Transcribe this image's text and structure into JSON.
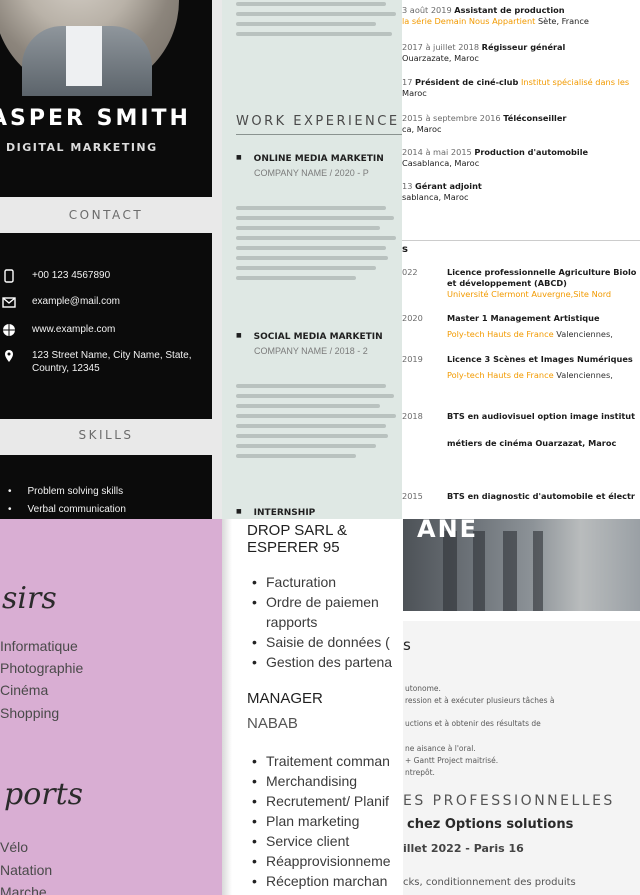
{
  "tile_a": {
    "name": "ASPER SMITH",
    "role": "DIGITAL MARKETING",
    "contact_title": "CONTACT",
    "contact": [
      {
        "icon": "phone-icon",
        "text": "+00 123 4567890"
      },
      {
        "icon": "email-icon",
        "text": "example@mail.com"
      },
      {
        "icon": "globe-icon",
        "text": "www.example.com"
      },
      {
        "icon": "location-pin-icon",
        "text": "123 Street Name, City Name, State, Country, 12345"
      }
    ],
    "skills_title": "SKILLS",
    "skills": [
      "Problem solving skills",
      "Verbal communication"
    ]
  },
  "tile_b": {
    "title": "WORK EXPERIENCE",
    "jobs": [
      {
        "title": "ONLINE MEDIA MARKETIN",
        "sub": "COMPANY NAME / 2020 - P"
      },
      {
        "title": "SOCIAL MEDIA MARKETIN",
        "sub": "COMPANY NAME / 2018 - 2"
      },
      {
        "title": "INTERNSHIP",
        "sub": ""
      }
    ]
  },
  "tile_c": {
    "experience": [
      {
        "date": "3 août 2019",
        "title": "Assistant de production",
        "org": "la série Demain Nous Appartient",
        "place": "Sète, France"
      },
      {
        "date": "2017 à juillet 2018",
        "title": "Régisseur général",
        "org": "",
        "place": "Ouarzazate, Maroc"
      },
      {
        "date": "17",
        "title": "Président de ciné-club",
        "org": "Institut spécialisé dans les",
        "place": "Maroc"
      },
      {
        "date": "2015 à septembre 2016",
        "title": "Téléconseiller",
        "org": "",
        "place": "ca, Maroc"
      },
      {
        "date": "2014 à mai 2015",
        "title": "Production d'automobile",
        "org": "",
        "place": "Casablanca, Maroc"
      },
      {
        "date": "13",
        "title": "Gérant adjoint",
        "org": "",
        "place": "sablanca, Maroc"
      }
    ],
    "section_mark": "s",
    "education": [
      {
        "year": "022",
        "title": "Licence professionnelle Agriculture Biolo",
        "title2": "et développement (ABCD)",
        "org": "Université Clermont Auvergne,Site Nord",
        "place": ""
      },
      {
        "year": "2020",
        "title": "Master 1 Management Artistique",
        "title2": "",
        "org": "Poly-tech Hauts de France",
        "place": "Valenciennes,"
      },
      {
        "year": "2019",
        "title": "Licence 3 Scènes et Images Numériques",
        "title2": "",
        "org": "Poly-tech Hauts de France",
        "place": "Valenciennes,"
      },
      {
        "year": "2018",
        "title": "BTS en audiovisuel option image institut",
        "title2": "",
        "org": "",
        "place": ""
      },
      {
        "year": "",
        "title": "métiers de cinéma Ouarzazat, Maroc",
        "title2": "",
        "org": "",
        "place": ""
      },
      {
        "year": "2015",
        "title": "BTS en diagnostic d'automobile et électr",
        "title2": "",
        "org": "",
        "place": ""
      }
    ]
  },
  "tile_d": {
    "heading1": "sirs",
    "hobbies": [
      "Informatique",
      "Photographie",
      "Cinéma",
      "Shopping"
    ],
    "heading2": "ports",
    "sports": [
      "Vélo",
      "Natation",
      "Marche"
    ]
  },
  "tile_e": {
    "company1": "DROP SARL &",
    "company1b": "ESPERER 95",
    "tasks1": [
      "Facturation",
      "Ordre de paiemen",
      "rapports",
      "Saisie de données (",
      "Gestion des partena"
    ],
    "role2": "MANAGER",
    "company2": "NABAB",
    "tasks2": [
      "Traitement comman",
      "Merchandising",
      "Recrutement/ Planif",
      "Plan marketing",
      "Service client",
      "Réapprovisionneme",
      "Réception marchan"
    ]
  },
  "tile_f": {
    "photo_mark": "ANE",
    "s_mark": "s",
    "lines": [
      "utonome.",
      "ression et à exécuter plusieurs tâches à",
      "uctions et à obtenir des résultats de",
      "ne aisance à l'oral.",
      "+ Gantt Project maitrisé.",
      "ntrepôt."
    ],
    "heading": "ES PROFESSIONNELLES",
    "sub1": "chez Options solutions",
    "sub2": "illet 2022 - Paris 16",
    "sub3": "cks, conditionnement des produits"
  }
}
